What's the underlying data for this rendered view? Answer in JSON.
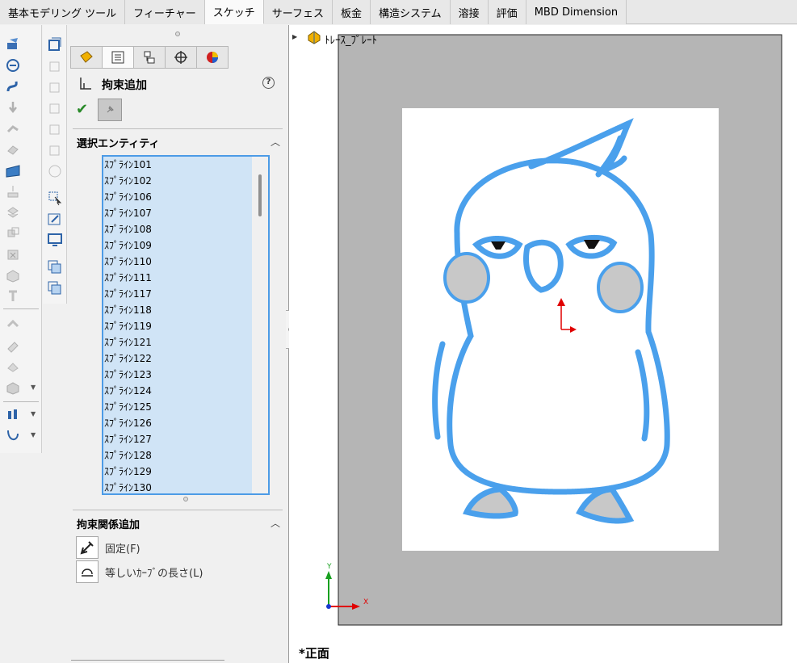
{
  "tabs": [
    {
      "label": "基本モデリング ツール"
    },
    {
      "label": "フィーチャー"
    },
    {
      "label": "スケッチ",
      "active": true
    },
    {
      "label": "サーフェス"
    },
    {
      "label": "板金"
    },
    {
      "label": "構造システム"
    },
    {
      "label": "溶接"
    },
    {
      "label": "評価"
    },
    {
      "label": "MBD Dimension"
    }
  ],
  "property_manager": {
    "tab_icons": [
      "feature-manager-icon",
      "property-manager-icon",
      "configuration-manager-icon",
      "dimxpert-icon",
      "display-manager-icon"
    ],
    "title": "拘束追加",
    "help": "?",
    "selected_entities": {
      "title": "選択エンティティ",
      "items": [
        "ｽﾌﾟﾗｲﾝ101",
        "ｽﾌﾟﾗｲﾝ102",
        "ｽﾌﾟﾗｲﾝ106",
        "ｽﾌﾟﾗｲﾝ107",
        "ｽﾌﾟﾗｲﾝ108",
        "ｽﾌﾟﾗｲﾝ109",
        "ｽﾌﾟﾗｲﾝ110",
        "ｽﾌﾟﾗｲﾝ111",
        "ｽﾌﾟﾗｲﾝ117",
        "ｽﾌﾟﾗｲﾝ118",
        "ｽﾌﾟﾗｲﾝ119",
        "ｽﾌﾟﾗｲﾝ121",
        "ｽﾌﾟﾗｲﾝ122",
        "ｽﾌﾟﾗｲﾝ123",
        "ｽﾌﾟﾗｲﾝ124",
        "ｽﾌﾟﾗｲﾝ125",
        "ｽﾌﾟﾗｲﾝ126",
        "ｽﾌﾟﾗｲﾝ127",
        "ｽﾌﾟﾗｲﾝ128",
        "ｽﾌﾟﾗｲﾝ129",
        "ｽﾌﾟﾗｲﾝ130"
      ]
    },
    "add_relations": {
      "title": "拘束関係追加",
      "items": [
        {
          "label": "固定(F)",
          "icon": "anchor-fix-icon"
        },
        {
          "label": "等しいｶｰﾌﾞの長さ(L)",
          "icon": "equal-curve-icon"
        }
      ]
    }
  },
  "viewport": {
    "tree_item": "ﾄﾚｰｽ_ﾌﾟﾚｰﾄ",
    "view_label": "*正面",
    "triad": {
      "x": "X",
      "y": "Y"
    }
  },
  "colors": {
    "selection_blue": "#4c9be6",
    "list_bg": "#d0e4f6",
    "graphics_gray": "#b5b5b5",
    "origin_red": "#e00000"
  }
}
